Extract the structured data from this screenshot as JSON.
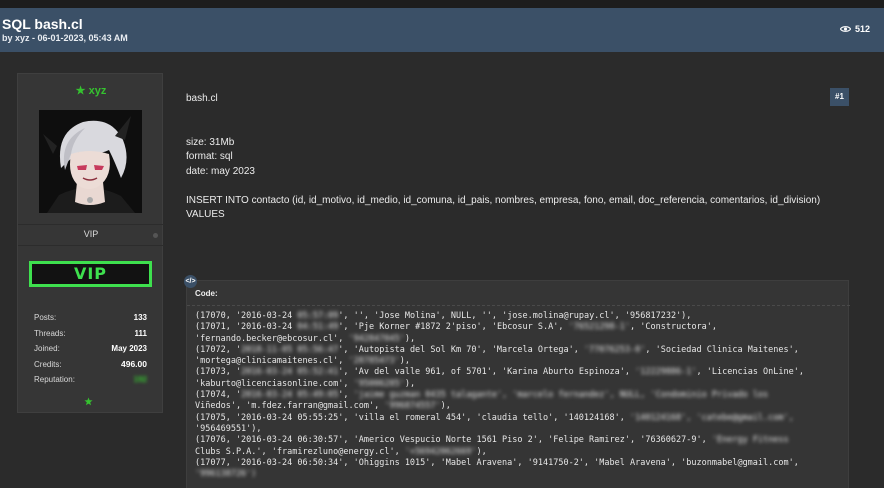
{
  "thread": {
    "title": "SQL bash.cl",
    "meta": "by xyz - 06-01-2023, 05:43 AM",
    "views": "512"
  },
  "author": {
    "username": "xyz",
    "rank": "VIP",
    "badge_text": "VIP",
    "stats": [
      {
        "label": "Posts:",
        "value": "133"
      },
      {
        "label": "Threads:",
        "value": "111"
      },
      {
        "label": "Joined:",
        "value": "May 2023"
      },
      {
        "label": "Credits:",
        "value": "496.00"
      },
      {
        "label": "Reputation:",
        "value": "192"
      }
    ]
  },
  "post": {
    "number": "#1",
    "lines": [
      "bash.cl",
      "",
      "",
      "size: 31Mb",
      "format: sql",
      "date:  may 2023",
      "",
      "INSERT INTO contacto (id, id_motivo, id_medio, id_comuna, id_pais, nombres, empresa, fono, email, doc_referencia, comentarios, id_division)",
      "VALUES"
    ]
  },
  "code": {
    "label": "Code:",
    "lines": [
      [
        {
          "t": "(17070, '2016-03-24 "
        },
        {
          "t": "05:57:09",
          "b": true
        },
        {
          "t": "', '', 'Jose Molina', NULL, '', 'jose.molina@rupay.cl', '956817232'),"
        }
      ],
      [
        {
          "t": "(17071, '2016-03-24 "
        },
        {
          "t": "04:51:49",
          "b": true
        },
        {
          "t": "', 'Pje Korner #1872 2'piso', 'Ebcosur S.A', "
        },
        {
          "t": "'76521298-1'",
          "b": true
        },
        {
          "t": ", 'Constructora',"
        }
      ],
      [
        {
          "t": "'fernando.becker@ebcosur.cl', "
        },
        {
          "t": "'942847045'",
          "b": true
        },
        {
          "t": "),"
        }
      ],
      [
        {
          "t": "(17072, '"
        },
        {
          "t": "2018-11-05 05:56:47",
          "b": true
        },
        {
          "t": "', 'Autopista del Sol Km 70', 'Marcela Ortega', "
        },
        {
          "t": "'77076253-0'",
          "b": true
        },
        {
          "t": ", 'Sociedad Clinica Maitenes',"
        }
      ],
      [
        {
          "t": "'mortega@clinicamaitenes.cl', "
        },
        {
          "t": "'28785473'",
          "b": true
        },
        {
          "t": "),"
        }
      ],
      [
        {
          "t": "(17073, '"
        },
        {
          "t": "2016-03-24 05:52:41",
          "b": true
        },
        {
          "t": "', 'Av del valle 961, of 5701', 'Karina Aburto Espinoza', "
        },
        {
          "t": "'12229886-1'",
          "b": true
        },
        {
          "t": ", 'Licencias OnLine',"
        }
      ],
      [
        {
          "t": "'kaburto@licenciasonline.com', "
        },
        {
          "t": "'95006285'",
          "b": true
        },
        {
          "t": "),"
        }
      ],
      [
        {
          "t": "(17074, '"
        },
        {
          "t": "2016-03-24 05:49:05",
          "b": true
        },
        {
          "t": "', "
        },
        {
          "t": "'jaime guzman 0435 talagante', 'marcelo fernandez', NULL, 'Condominio Privado los",
          "b": true
        }
      ],
      [
        {
          "t": "Viñedos', 'm.fdez.farran@gmail.com', "
        },
        {
          "t": "'996874557'",
          "b": true
        },
        {
          "t": "),"
        }
      ],
      [
        {
          "t": "(17075, '2016-03-24 05:55:25', 'villa el romeral 454', 'claudia tello', '140124168', "
        },
        {
          "t": "'140124168', 'catebe@gmail.com',",
          "b": true
        }
      ],
      [
        {
          "t": "'956469551'),"
        }
      ],
      [
        {
          "t": "(17076, '2016-03-24 06:30:57', 'Americo Vespucio Norte 1561 Piso 2', 'Felipe Ramirez', '76360627-9', "
        },
        {
          "t": "'Energy Fitness",
          "b": true
        }
      ],
      [
        {
          "t": "Clubs S.P.A.', 'framirezluno@energy.cl', "
        },
        {
          "t": "'+56942062669'",
          "b": true
        },
        {
          "t": "),"
        }
      ],
      [
        {
          "t": "(17077, '2016-03-24 06:50:34', 'Ohiggins 1015', 'Mabel Aravena', '9141750-2', 'Mabel Aravena', 'buzonmabel@gmail.com',"
        }
      ],
      [
        {
          "t": "'996138726')",
          "b": true
        }
      ]
    ]
  },
  "colors": {
    "accent": "#3b5067",
    "online_green": "#35c22f",
    "vip_badge": "#3ee04e",
    "background": "#2b2b2b"
  },
  "icons": [
    "eye-icon",
    "star-icon",
    "code-icon"
  ]
}
